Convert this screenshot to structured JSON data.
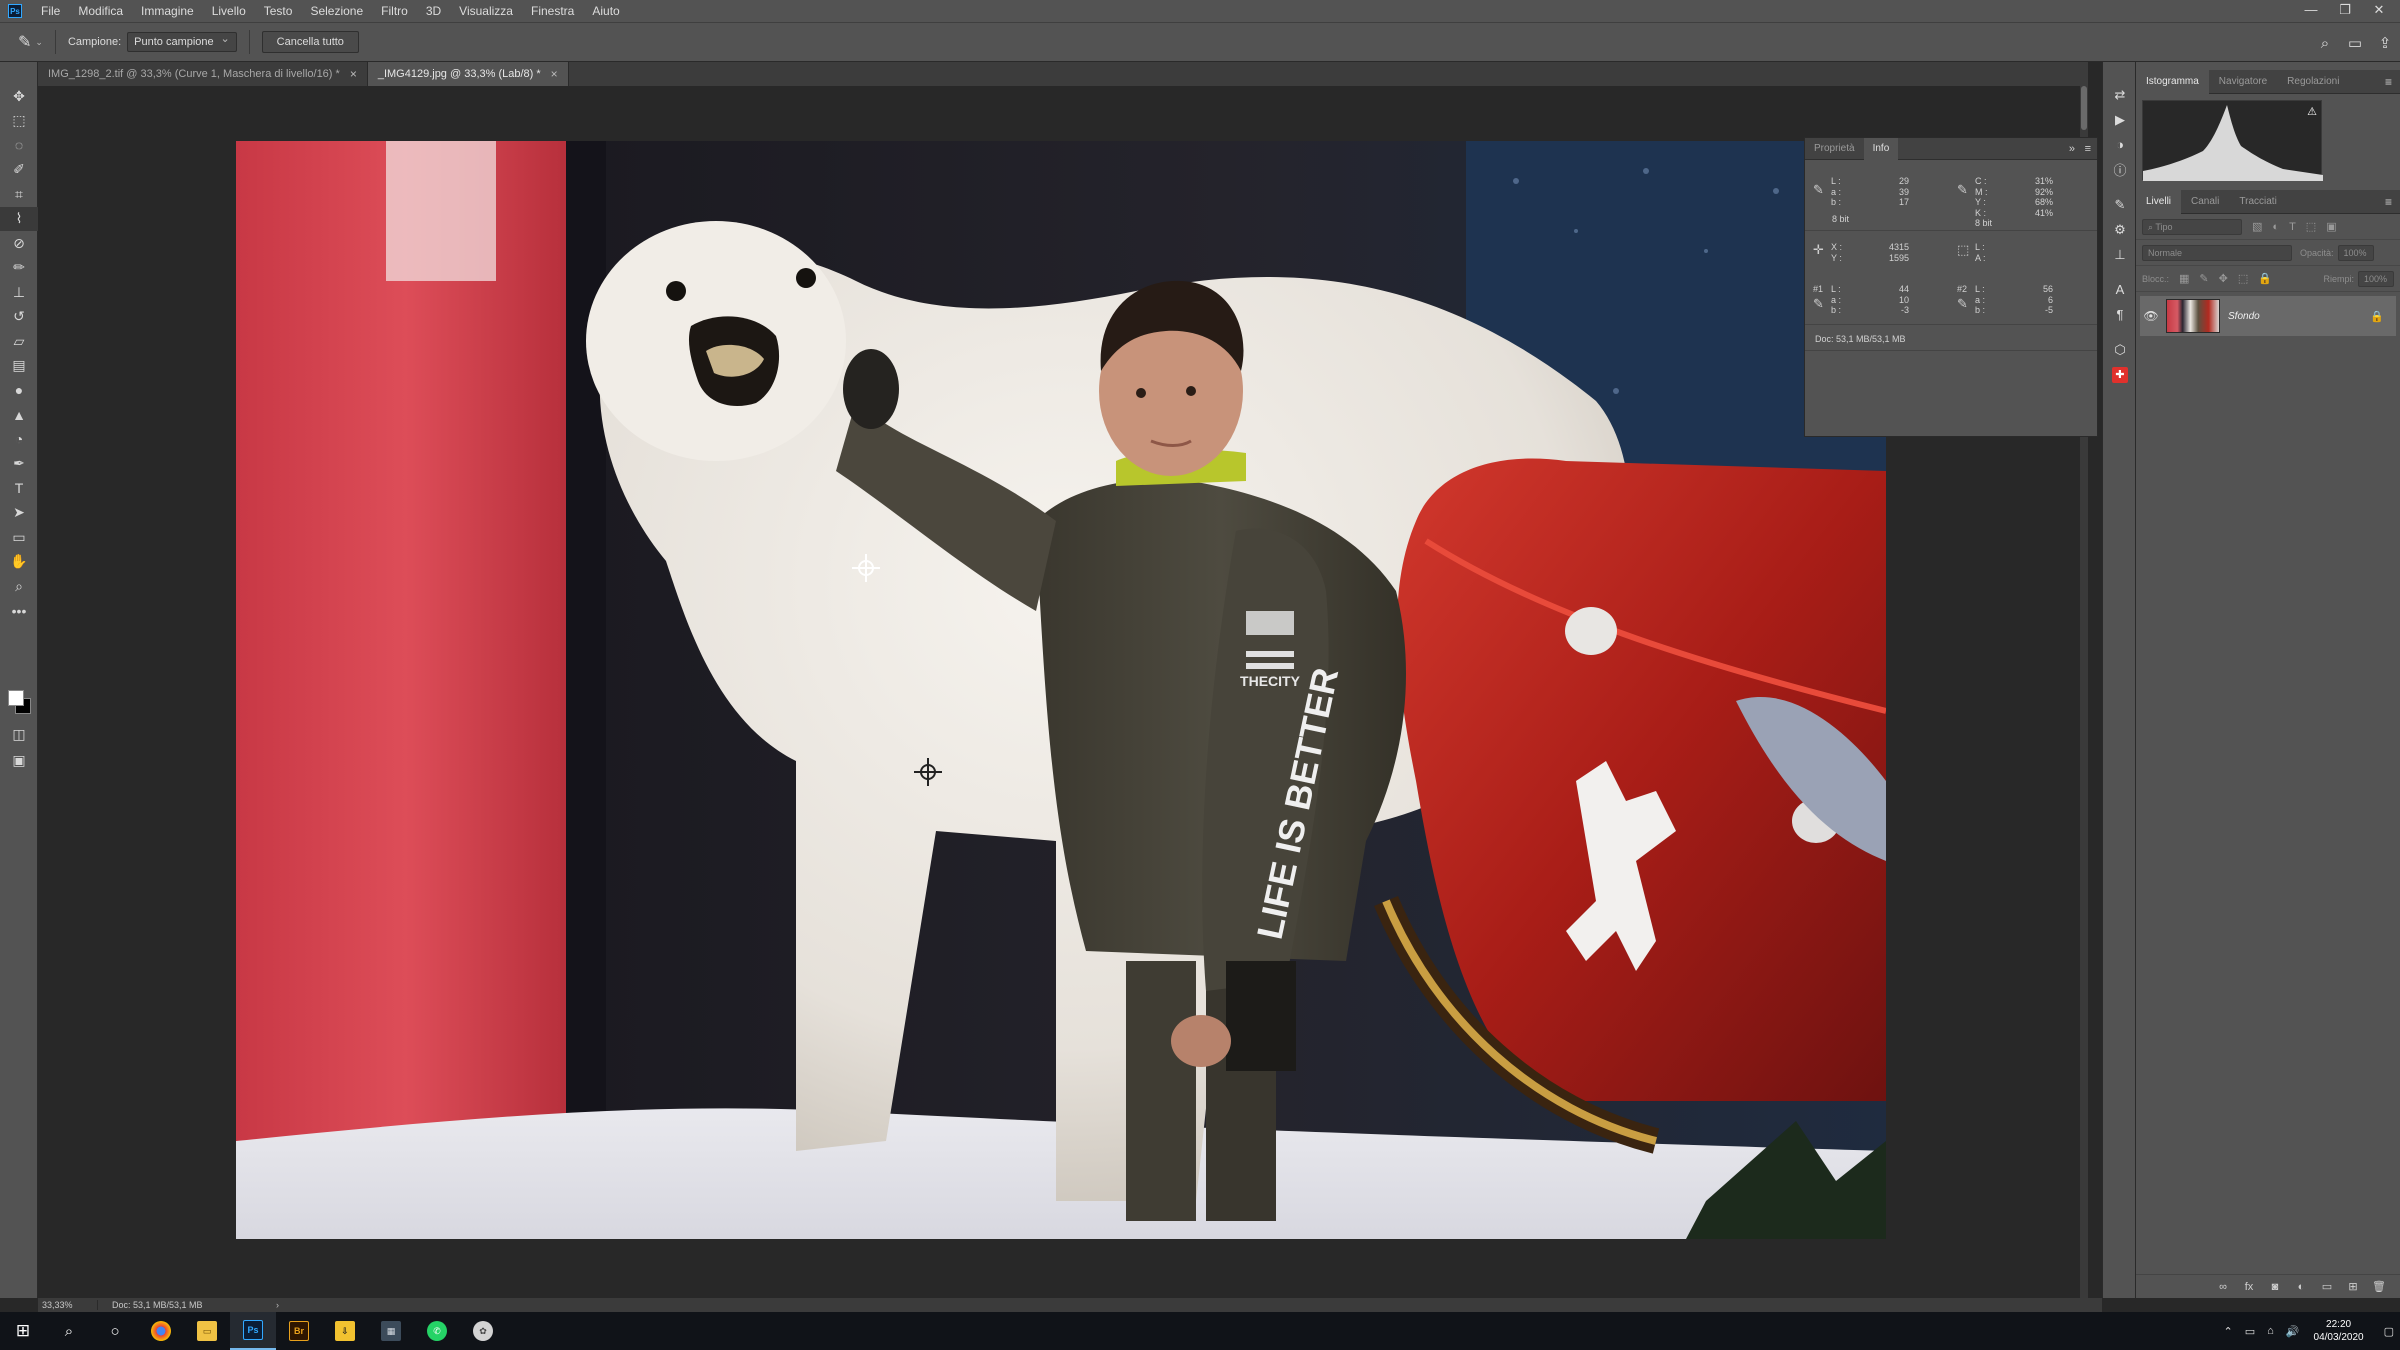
{
  "app": {
    "logo_text": "Ps"
  },
  "menubar": {
    "items": [
      "File",
      "Modifica",
      "Immagine",
      "Livello",
      "Testo",
      "Selezione",
      "Filtro",
      "3D",
      "Visualizza",
      "Finestra",
      "Aiuto"
    ],
    "window_controls": [
      "—",
      "❐",
      "✕"
    ]
  },
  "optionsbar": {
    "sample_label": "Campione:",
    "sample_value": "Punto campione",
    "clear_button": "Cancella tutto"
  },
  "tabs": [
    {
      "label": "IMG_1298_2.tif @ 33,3% (Curve 1, Maschera di livello/16) *",
      "active": false
    },
    {
      "label": "_IMG4129.jpg @ 33,3% (Lab/8) *",
      "active": true
    }
  ],
  "info_panel": {
    "tabs": [
      "Proprietà",
      "Info"
    ],
    "active_tab": "Info",
    "lab_labels": [
      "L :",
      "a :",
      "b :"
    ],
    "lab_values": [
      "29",
      "39",
      "17"
    ],
    "lab_bits": "8 bit",
    "cmyk_labels": [
      "C :",
      "M :",
      "Y :",
      "K :"
    ],
    "cmyk_values": [
      "31%",
      "92%",
      "68%",
      "41%"
    ],
    "cmyk_bits": "8 bit",
    "xy_labels": [
      "X :",
      "Y :"
    ],
    "xy_values": [
      "4315",
      "1595"
    ],
    "wh_labels": [
      "L :",
      "A :"
    ],
    "sample1_tag": "#1",
    "sample1_labels": [
      "L :",
      "a :",
      "b :"
    ],
    "sample1_values": [
      "44",
      "10",
      "-3"
    ],
    "sample2_tag": "#2",
    "sample2_labels": [
      "L :",
      "a :",
      "b :"
    ],
    "sample2_values": [
      "56",
      "6",
      "-5"
    ],
    "doc_size": "Doc: 53,1 MB/53,1 MB"
  },
  "histogram_panel": {
    "tabs": [
      "Istogramma",
      "Navigatore",
      "Regolazioni"
    ],
    "active_tab": "Istogramma"
  },
  "layers_panel": {
    "tabs": [
      "Livelli",
      "Canali",
      "Tracciati"
    ],
    "active_tab": "Livelli",
    "filter_placeholder": "Tipo",
    "blend_mode": "Normale",
    "opacity_label": "Opacità:",
    "opacity_value": "100%",
    "lock_label": "Blocc.:",
    "fill_label": "Riempi:",
    "fill_value": "100%",
    "layers": [
      {
        "name": "Sfondo",
        "visible": true,
        "locked": true
      }
    ]
  },
  "statusbar": {
    "zoom": "33,33%",
    "doc": "Doc: 53,1 MB/53,1 MB"
  },
  "taskbar": {
    "time": "22:20",
    "date": "04/03/2020"
  },
  "image_text": {
    "sleeve_brand": "THECITY",
    "sleeve_slogan": "LIFE IS BETTER"
  },
  "colors": {
    "ps_blue": "#31a8ff",
    "panel_bg": "#535353",
    "canvas_bg": "#282828",
    "sleigh_red": "#b3211b",
    "curtain_red": "#d84250"
  }
}
